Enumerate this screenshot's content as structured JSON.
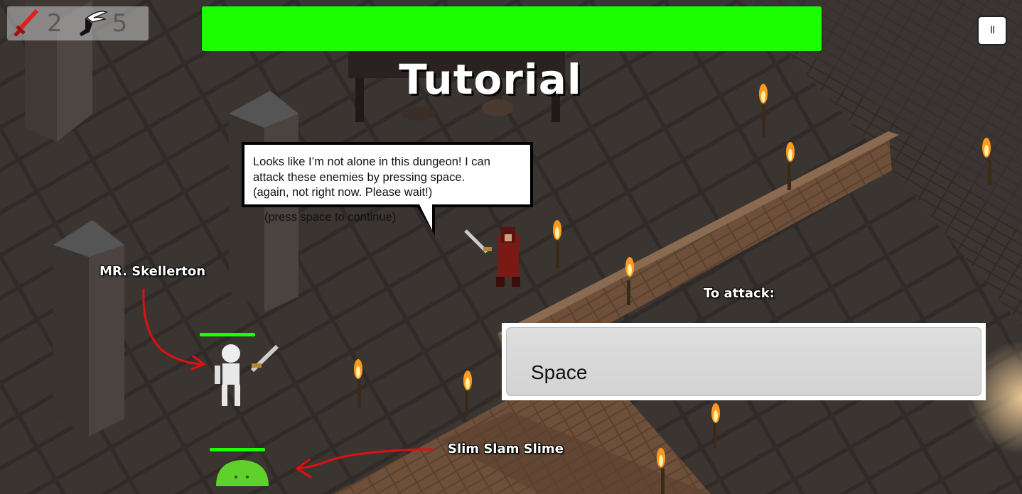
{
  "hud": {
    "attack_value": "2",
    "speed_value": "5",
    "attack_icon": "sword-icon",
    "speed_icon": "winged-boot-icon"
  },
  "player_health": {
    "fraction": 1.0,
    "color": "#1cff00"
  },
  "title": "Tutorial",
  "pause_button": {
    "label": "II",
    "icon": "pause-icon"
  },
  "dialog": {
    "lines": [
      "Looks like I’m not alone in this dungeon! I can",
      "attack these enemies by pressing space.",
      "(again, not right now. Please wait!)"
    ],
    "continue_hint": "(press space to continue)"
  },
  "annotations": {
    "skeleton_label": "MR. Skellerton",
    "slime_label": "Slim Slam Slime",
    "attack_label": "To attack:"
  },
  "attack_key": {
    "label": "Space"
  },
  "enemies": {
    "skeleton_health": 1.0,
    "slime_health": 1.0
  },
  "colors": {
    "health": "#1cff00",
    "arrow": "#e01010",
    "sword": "#e02020"
  }
}
